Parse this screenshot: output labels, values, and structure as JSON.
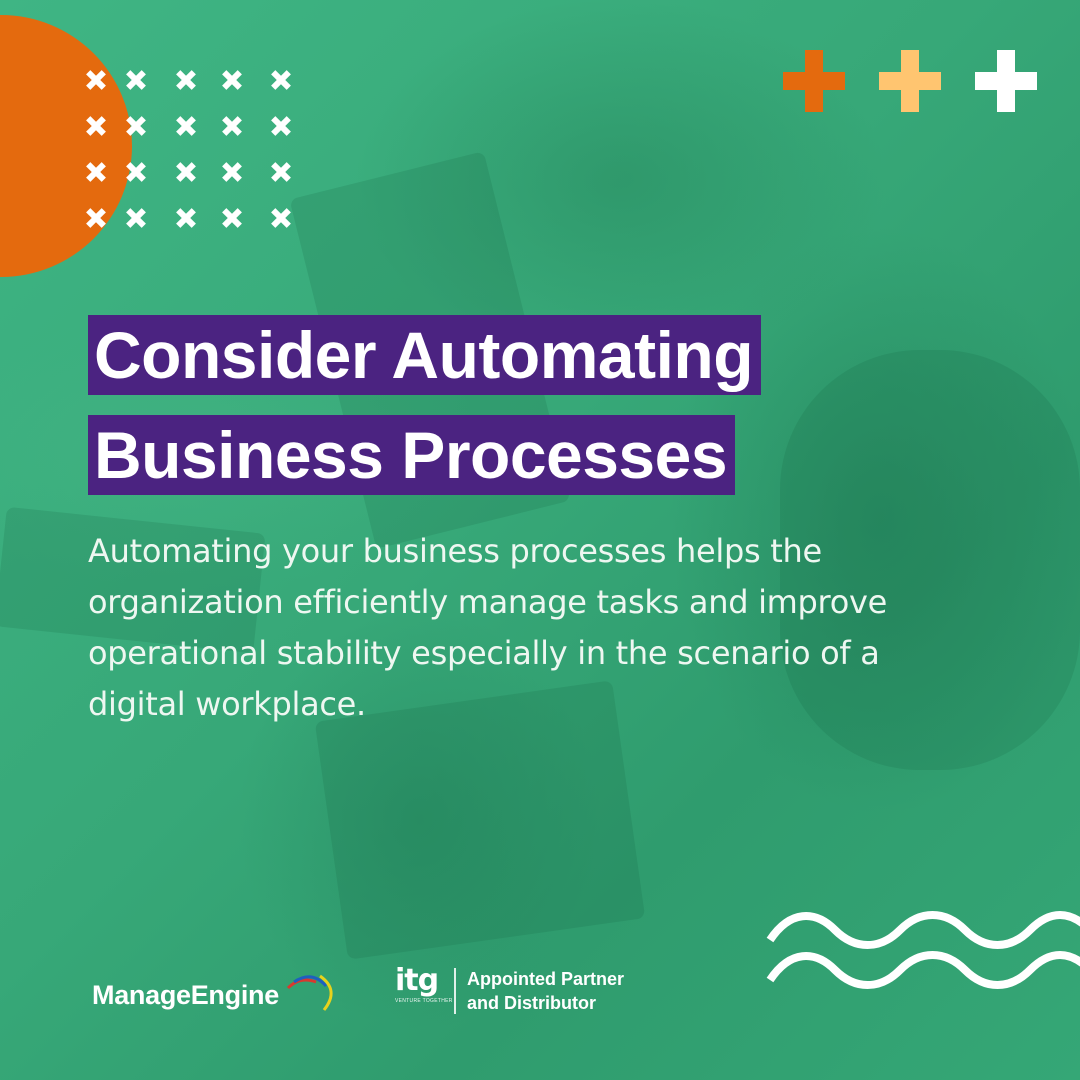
{
  "headline": {
    "line1": "Consider Automating",
    "line2": "Business Processes"
  },
  "body": "Automating your business processes helps the organization efficiently manage tasks and improve operational stability especially in the scenario of a digital workplace.",
  "footer": {
    "brand_logo": "ManageEngine",
    "partner_logo": "itg",
    "partner_tagline": "VENTURE TOGETHER",
    "partner_line1": "Appointed Partner",
    "partner_line2": "and Distributor"
  },
  "decor": {
    "x_grid": {
      "rows": 4,
      "cols": 5
    },
    "plus_icons": [
      "orange-plus-icon",
      "light-orange-plus-icon",
      "white-plus-icon"
    ],
    "wave_lines": 2
  },
  "colors": {
    "background": "#37a878",
    "headline_bg": "#4b2381",
    "orange": "#e46a0e",
    "light_orange": "#ffc570",
    "white": "#ffffff",
    "logo_arc_red": "#d9382e",
    "logo_arc_blue": "#1f5fbf",
    "logo_arc_yellow": "#e7d21c"
  }
}
